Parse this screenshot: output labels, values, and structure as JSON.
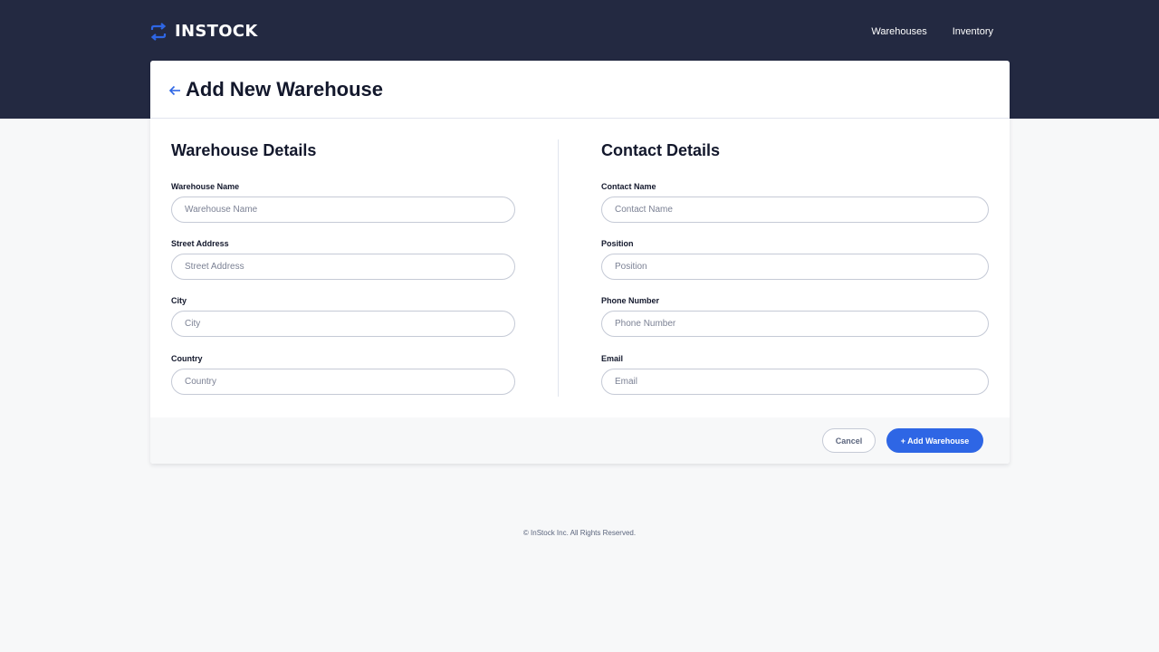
{
  "brand": {
    "name": "INSTOCK",
    "accent_color": "#2e66e5",
    "header_color": "#232941"
  },
  "nav": {
    "items": [
      {
        "label": "Warehouses"
      },
      {
        "label": "Inventory"
      }
    ]
  },
  "page": {
    "title": "Add New Warehouse",
    "back_icon": "arrow-left-icon"
  },
  "warehouse_details": {
    "title": "Warehouse Details",
    "fields": [
      {
        "label": "Warehouse Name",
        "placeholder": "Warehouse Name",
        "value": ""
      },
      {
        "label": "Street Address",
        "placeholder": "Street Address",
        "value": ""
      },
      {
        "label": "City",
        "placeholder": "City",
        "value": ""
      },
      {
        "label": "Country",
        "placeholder": "Country",
        "value": ""
      }
    ]
  },
  "contact_details": {
    "title": "Contact Details",
    "fields": [
      {
        "label": "Contact Name",
        "placeholder": "Contact Name",
        "value": ""
      },
      {
        "label": "Position",
        "placeholder": "Position",
        "value": ""
      },
      {
        "label": "Phone Number",
        "placeholder": "Phone Number",
        "value": ""
      },
      {
        "label": "Email",
        "placeholder": "Email",
        "value": ""
      }
    ]
  },
  "actions": {
    "cancel_label": "Cancel",
    "add_label": "+ Add Warehouse"
  },
  "footer": {
    "copyright": "© InStock Inc. All Rights Reserved."
  }
}
